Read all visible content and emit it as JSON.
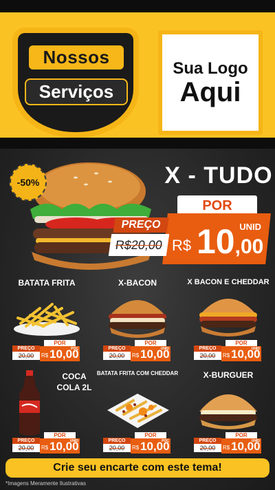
{
  "header": {
    "badge_line1": "Nossos",
    "badge_line2": "Serviços",
    "logo_line1": "Sua Logo",
    "logo_line2": "Aqui"
  },
  "hero": {
    "discount": "-50%",
    "title": "X - TUDO",
    "por_label": "POR",
    "preco_label": "PREÇO",
    "old_price": "R$20,00",
    "currency": "R$",
    "price_main": "10",
    "price_cents": ",00",
    "unit_label": "UNID"
  },
  "products": [
    {
      "name": "BATATA FRITA",
      "preco_label": "PREÇO",
      "old_price": "20,00",
      "por_label": "POR",
      "currency": "R$",
      "price": "10,00",
      "unit_label": "POÇ"
    },
    {
      "name": "X-BACON",
      "preco_label": "PREÇO",
      "old_price": "20,00",
      "por_label": "POR",
      "currency": "R$",
      "price": "10,00",
      "unit_label": "UNID"
    },
    {
      "name": "X BACON E CHEDDAR",
      "preco_label": "PREÇO",
      "old_price": "20,00",
      "por_label": "POR",
      "currency": "R$",
      "price": "10,00",
      "unit_label": "UNID"
    },
    {
      "name": "COCA COLA 2L",
      "preco_label": "PREÇO",
      "old_price": "20,00",
      "por_label": "POR",
      "currency": "R$",
      "price": "10,00",
      "unit_label": "UNID"
    },
    {
      "name": "BATATA FRITA COM CHEDDAR",
      "preco_label": "PREÇO",
      "old_price": "20,00",
      "por_label": "POR",
      "currency": "R$",
      "price": "10,00",
      "unit_label": "POÇ"
    },
    {
      "name": "X-BURGUER",
      "preco_label": "PREÇO",
      "old_price": "20,00",
      "por_label": "POR",
      "currency": "R$",
      "price": "10,00",
      "unit_label": "UNID"
    }
  ],
  "footer": {
    "cta": "Crie seu encarte com este tema!",
    "disclaimer": "*Imagens Meramente Ilustrativas"
  },
  "colors": {
    "yellow": "#fbc223",
    "orange": "#e85d10",
    "dark": "#0d0d0d",
    "panel": "#2b2b2b"
  }
}
